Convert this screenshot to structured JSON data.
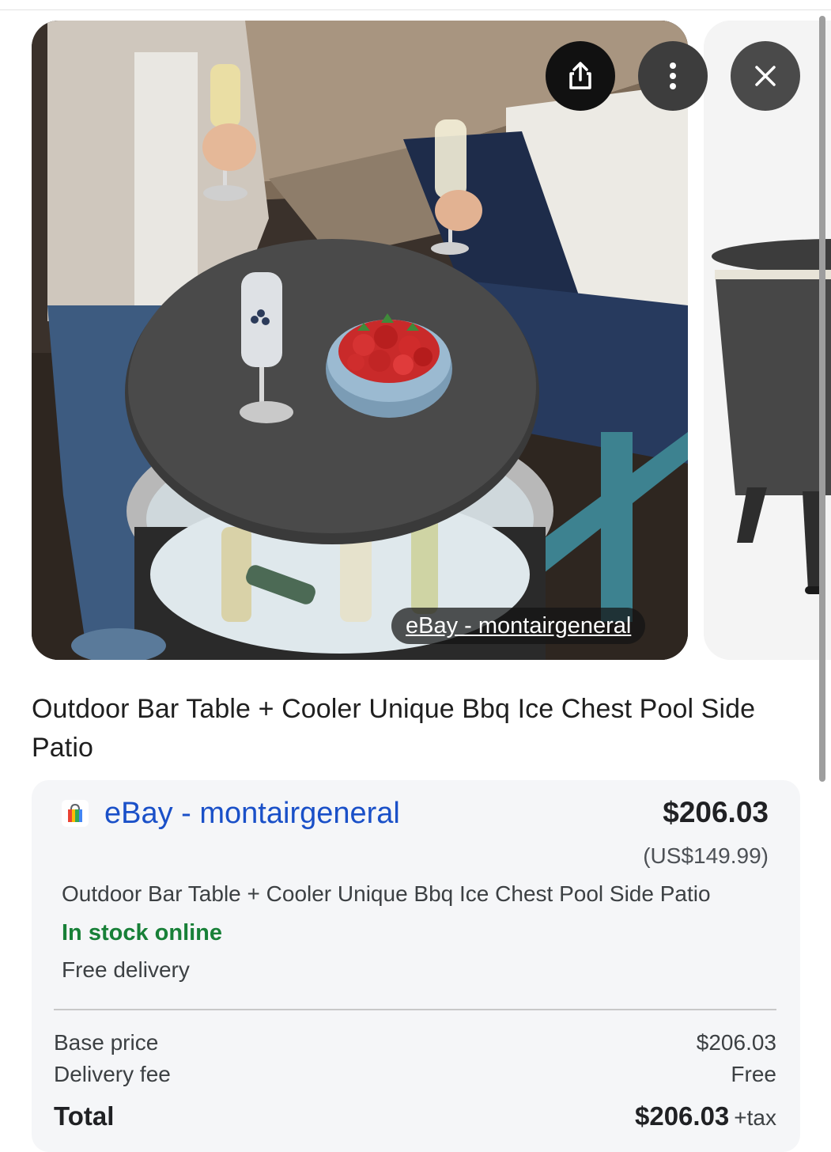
{
  "image_viewer": {
    "source_chip": "eBay - montairgeneral",
    "buttons": {
      "share_icon": "share-icon",
      "more_icon": "more-vertical-icon",
      "close_icon": "close-icon"
    }
  },
  "product": {
    "title": "Outdoor Bar Table + Cooler Unique Bbq Ice Chest Pool Side Patio"
  },
  "offer": {
    "store_icon": "shopping-bag-icon",
    "store_name": "eBay - montairgeneral",
    "price": "$206.03",
    "original_price": "(US$149.99)",
    "description": "Outdoor Bar Table + Cooler Unique Bbq Ice Chest Pool Side Patio",
    "stock": "In stock online",
    "delivery": "Free delivery",
    "breakdown": {
      "base_label": "Base price",
      "base_value": "$206.03",
      "delivery_label": "Delivery fee",
      "delivery_value": "Free",
      "total_label": "Total",
      "total_value": "$206.03",
      "tax_note": "+tax"
    }
  },
  "colors": {
    "link_blue": "#1a50c8",
    "stock_green": "#188038",
    "card_bg": "#f5f6f8"
  }
}
